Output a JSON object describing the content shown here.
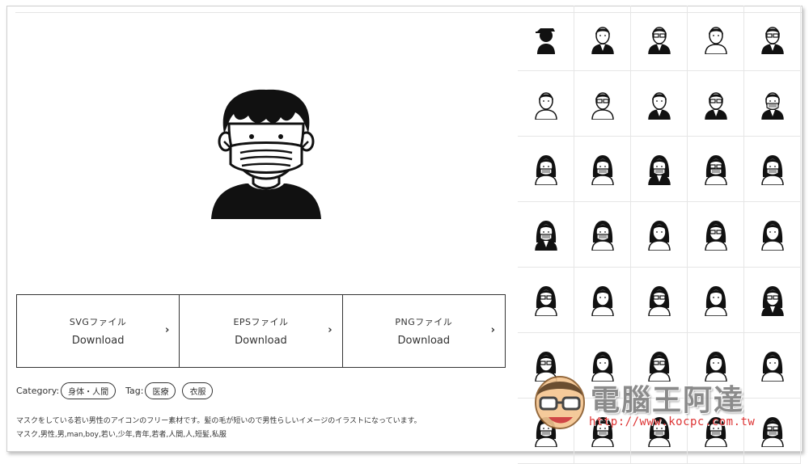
{
  "downloads": [
    {
      "type": "SVGファイル",
      "label": "Download"
    },
    {
      "type": "EPSファイル",
      "label": "Download"
    },
    {
      "type": "PNGファイル",
      "label": "Download"
    }
  ],
  "meta": {
    "category_label": "Category:",
    "category": "身体・人間",
    "tag_label": "Tag:",
    "tags": [
      "医療",
      "衣服"
    ]
  },
  "description": "マスクをしている若い男性のアイコンのフリー素材です。髪の毛が短いので男性らしいイメージのイラストになっています。",
  "keywords": "マスク,男性,男,man,boy,若い,少年,青年,若者,人間,人,短髪,私服",
  "watermark": {
    "title": "電腦王阿達",
    "url": "http://www.kocpc.com.tw"
  },
  "grid_icons": [
    "cap-person",
    "suit-man",
    "glasses-suit-man",
    "man-shirt",
    "glasses-tie-man",
    "man-plain",
    "glasses-man",
    "man-bowtie",
    "glasses-man-suit",
    "mask-man-suit",
    "mask-woman-long",
    "mask-woman",
    "mask-woman-suit",
    "mask-glasses-woman",
    "mask-woman-bob",
    "mask-woman-bowtie",
    "mask-woman-ponytail",
    "woman-long",
    "glasses-woman",
    "woman-bow",
    "glasses-woman-long",
    "woman-bob",
    "glasses-woman-bob",
    "woman-long-plain",
    "glasses-woman-bowtie",
    "glasses-woman-2",
    "woman-2",
    "glasses-woman-3",
    "woman-3",
    "woman-4",
    "mask-woman-2",
    "mask-woman-3",
    "mask-woman-4",
    "mask-woman-5",
    "mask-glasses-woman-2"
  ]
}
